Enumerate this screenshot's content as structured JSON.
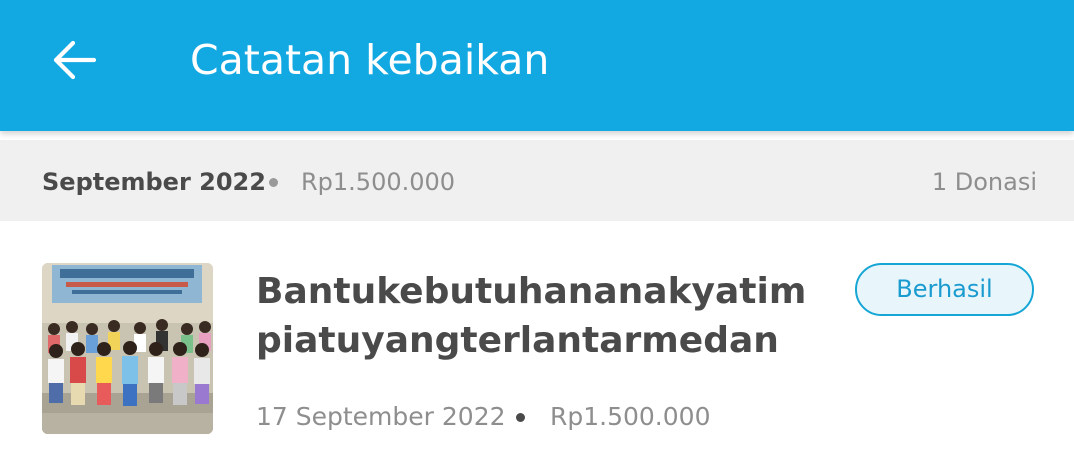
{
  "header": {
    "title": "Catatan kebaikan",
    "back_icon": "arrow-left-icon"
  },
  "colors": {
    "appbar": "#12a8e2",
    "status_border": "#16a6d6",
    "status_text": "#1a9bd0"
  },
  "month_group": {
    "label": "September 2022",
    "total": "Rp1.500.000",
    "count": "1 Donasi"
  },
  "donations": [
    {
      "title": "Bantukebutuhananakyatimpiatuyangterlantarmedan",
      "status": "Berhasil",
      "date": "17 September 2022",
      "amount": "Rp1.500.000",
      "thumbnail": "campaign-photo"
    }
  ]
}
